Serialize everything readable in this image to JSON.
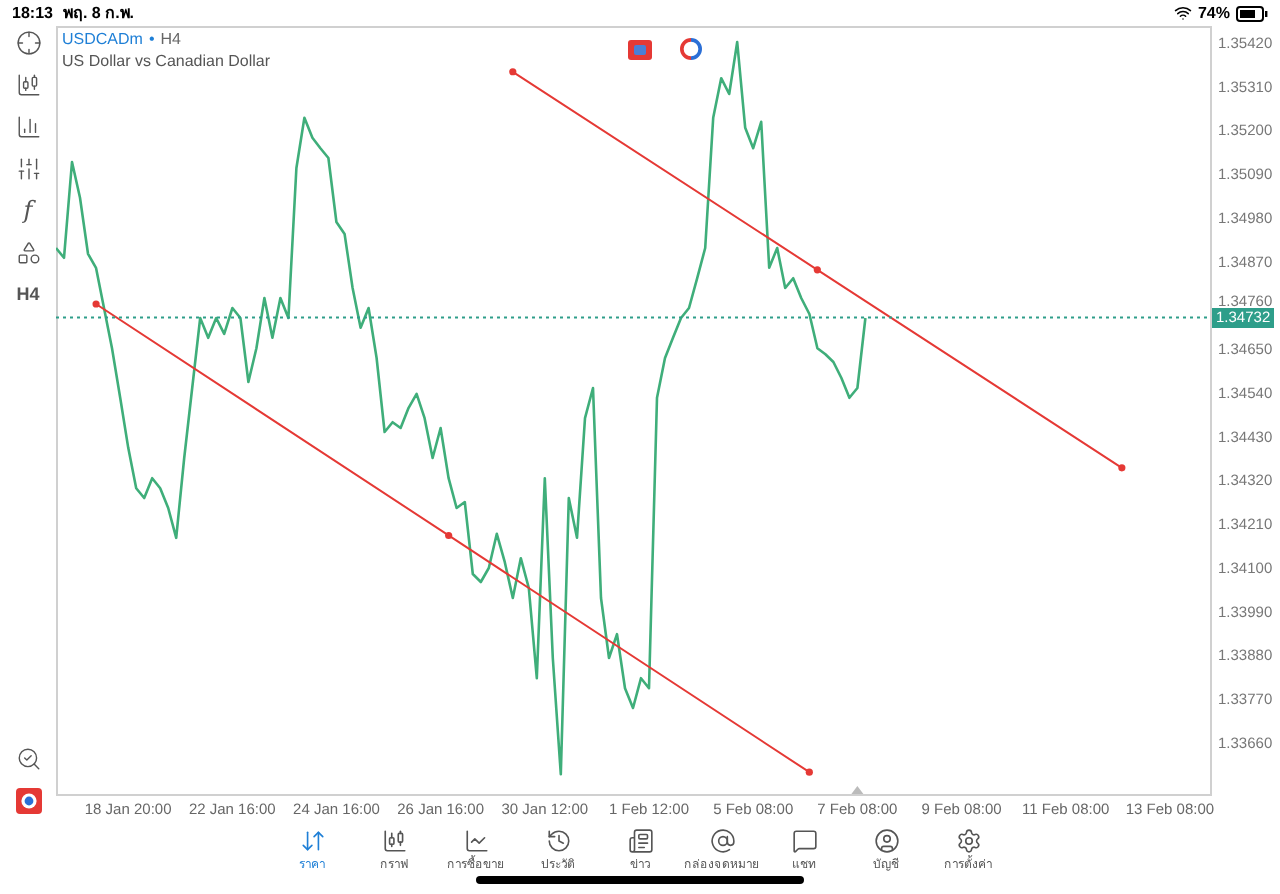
{
  "status_bar": {
    "time": "18:13",
    "date": "พฤ. 8 ก.พ.",
    "battery": "74%"
  },
  "left_toolbar": {
    "function_label": "f",
    "timeframe": "H4"
  },
  "chart_header": {
    "symbol": "USDCADm",
    "separator": "•",
    "timeframe": "H4",
    "description": "US Dollar vs Canadian Dollar"
  },
  "chart": {
    "chart_data": {
      "type": "line",
      "categories": [
        null,
        null,
        null,
        null,
        null,
        null,
        null,
        null,
        null,
        "18 Jan 20:00",
        null,
        null,
        null,
        null,
        null,
        null,
        null,
        null,
        null,
        null,
        null,
        null,
        "22 Jan 16:00",
        null,
        null,
        null,
        null,
        null,
        null,
        null,
        null,
        null,
        null,
        null,
        null,
        "24 Jan 16:00",
        null,
        null,
        null,
        null,
        null,
        null,
        null,
        null,
        null,
        null,
        null,
        null,
        "26 Jan 16:00",
        null,
        null,
        null,
        null,
        null,
        null,
        null,
        null,
        null,
        null,
        null,
        null,
        "30 Jan 12:00",
        null,
        null,
        null,
        null,
        null,
        null,
        null,
        null,
        null,
        null,
        null,
        null,
        "1 Feb 12:00",
        null,
        null,
        null,
        null,
        null,
        null,
        null,
        null,
        null,
        null,
        null,
        null,
        "5 Feb 08:00",
        null,
        null,
        null,
        null,
        null,
        null,
        null,
        null,
        null,
        null,
        null,
        null,
        "7 Feb 08:00",
        null,
        null,
        null,
        null,
        null,
        null,
        null,
        null,
        null,
        null,
        null,
        null,
        "9 Feb 08:00",
        null,
        null,
        null,
        null,
        null,
        null,
        null,
        null,
        null,
        null,
        null,
        null,
        "11 Feb 08:00",
        null,
        null,
        null,
        null,
        null,
        null,
        null,
        null,
        null,
        null,
        null,
        null,
        "13 Feb 08:00",
        null,
        null,
        null,
        null,
        null
      ],
      "ylim": [
        1.33534,
        1.35465
      ],
      "yticks": [
        {
          "value": 1.3542,
          "label": "1.35420"
        },
        {
          "value": 1.3531,
          "label": "1.35310"
        },
        {
          "value": 1.352,
          "label": "1.35200"
        },
        {
          "value": 1.3509,
          "label": "1.35090"
        },
        {
          "value": 1.3498,
          "label": "1.34980"
        },
        {
          "value": 1.3487,
          "label": "1.34870"
        },
        {
          "value": 1.3476,
          "label": "1.34760"
        },
        {
          "value": 1.3465,
          "label": "1.34650"
        },
        {
          "value": 1.3454,
          "label": "1.34540"
        },
        {
          "value": 1.3443,
          "label": "1.34430"
        },
        {
          "value": 1.3432,
          "label": "1.34320"
        },
        {
          "value": 1.3421,
          "label": "1.34210"
        },
        {
          "value": 1.341,
          "label": "1.34100"
        },
        {
          "value": 1.3399,
          "label": "1.33990"
        },
        {
          "value": 1.3388,
          "label": "1.33880"
        },
        {
          "value": 1.3377,
          "label": "1.33770"
        },
        {
          "value": 1.3366,
          "label": "1.33660"
        }
      ],
      "ref_lines": [
        {
          "axis": "y",
          "value": 1.34732,
          "label": "1.34732",
          "color": "#2e9e8a"
        }
      ],
      "series": [
        {
          "color": "#3fae7a",
          "values": [
            1.34907,
            1.34882,
            1.35123,
            1.35033,
            1.34892,
            1.34857,
            1.34756,
            1.34655,
            1.3453,
            1.34405,
            1.34303,
            1.34278,
            1.34328,
            1.34303,
            1.34253,
            1.34178,
            1.34379,
            1.34555,
            1.34731,
            1.34681,
            1.34731,
            1.34691,
            1.34756,
            1.34731,
            1.3457,
            1.34655,
            1.34781,
            1.34681,
            1.34781,
            1.34731,
            1.35108,
            1.35234,
            1.35184,
            1.35158,
            1.35133,
            1.34972,
            1.34942,
            1.34806,
            1.34706,
            1.34756,
            1.3463,
            1.34444,
            1.34469,
            1.34454,
            1.34505,
            1.3454,
            1.34479,
            1.34379,
            1.34454,
            1.34328,
            1.34253,
            1.34268,
            1.34087,
            1.34067,
            1.34102,
            1.34188,
            1.34117,
            1.34027,
            1.34127,
            1.34052,
            1.33825,
            1.34328,
            1.33876,
            1.33584,
            1.34278,
            1.34178,
            1.34479,
            1.34555,
            1.34027,
            1.33876,
            1.33936,
            1.338,
            1.3375,
            1.33825,
            1.338,
            1.3453,
            1.3463,
            1.34681,
            1.34731,
            1.34756,
            1.34831,
            1.34907,
            1.35234,
            1.35334,
            1.35294,
            1.35425,
            1.35209,
            1.35158,
            1.35224,
            1.34857,
            1.34907,
            1.34806,
            1.34831,
            1.34781,
            1.34741,
            1.34655,
            1.3464,
            1.3462,
            1.3458,
            1.3453,
            1.34555,
            1.34731,
            null,
            null,
            null,
            null,
            null,
            null,
            null,
            null,
            null,
            null,
            null,
            null,
            null,
            null,
            null,
            null,
            null,
            null,
            null,
            null,
            null,
            null,
            null,
            null,
            null,
            null,
            null,
            null,
            null,
            null,
            null,
            null,
            null,
            null,
            null,
            null,
            null,
            null,
            null,
            null,
            null,
            null,
            null
          ]
        },
        {
          "color": "#e53935",
          "marker": true,
          "values": [
            null,
            null,
            null,
            null,
            null,
            1.34766,
            null,
            null,
            null,
            null,
            null,
            null,
            null,
            null,
            null,
            null,
            null,
            null,
            null,
            null,
            null,
            null,
            null,
            null,
            null,
            null,
            null,
            null,
            null,
            null,
            null,
            null,
            null,
            null,
            null,
            null,
            null,
            null,
            null,
            null,
            null,
            null,
            null,
            null,
            null,
            null,
            null,
            null,
            null,
            1.34184,
            null,
            null,
            null,
            null,
            null,
            null,
            null,
            null,
            null,
            null,
            null,
            null,
            null,
            null,
            null,
            null,
            null,
            null,
            null,
            null,
            null,
            null,
            null,
            null,
            null,
            null,
            null,
            null,
            null,
            null,
            null,
            null,
            null,
            null,
            null,
            null,
            null,
            null,
            null,
            null,
            null,
            null,
            null,
            null,
            1.33589,
            null,
            null,
            null,
            null,
            null,
            null,
            null,
            null,
            null,
            null,
            null,
            null,
            null,
            null,
            null,
            null,
            null,
            null,
            null,
            null,
            null,
            null,
            null,
            null,
            null,
            null,
            null,
            null,
            null,
            null,
            null,
            null,
            null,
            null,
            null,
            null,
            null,
            null,
            null,
            null,
            null,
            null,
            null,
            null,
            null,
            null,
            null,
            null,
            null,
            null
          ]
        },
        {
          "color": "#e53935",
          "marker": true,
          "values": [
            null,
            null,
            null,
            null,
            null,
            null,
            null,
            null,
            null,
            null,
            null,
            null,
            null,
            null,
            null,
            null,
            null,
            null,
            null,
            null,
            null,
            null,
            null,
            null,
            null,
            null,
            null,
            null,
            null,
            null,
            null,
            null,
            null,
            null,
            null,
            null,
            null,
            null,
            null,
            null,
            null,
            null,
            null,
            null,
            null,
            null,
            null,
            null,
            null,
            null,
            null,
            null,
            null,
            null,
            null,
            null,
            null,
            1.3535,
            null,
            null,
            null,
            null,
            null,
            null,
            null,
            null,
            null,
            null,
            null,
            null,
            null,
            null,
            null,
            null,
            null,
            null,
            null,
            null,
            null,
            null,
            null,
            null,
            null,
            null,
            null,
            null,
            null,
            null,
            null,
            null,
            null,
            null,
            null,
            null,
            null,
            1.34852,
            null,
            null,
            null,
            null,
            null,
            null,
            null,
            null,
            null,
            null,
            null,
            null,
            null,
            null,
            null,
            null,
            null,
            null,
            null,
            null,
            null,
            null,
            null,
            null,
            null,
            null,
            null,
            null,
            null,
            null,
            null,
            null,
            null,
            null,
            null,
            null,
            null,
            1.34354,
            null,
            null,
            null,
            null,
            null,
            null,
            null,
            null,
            null,
            null,
            null
          ]
        }
      ]
    }
  },
  "tab_bar": [
    {
      "label": "ราคา",
      "kind": "quotes",
      "selected": true
    },
    {
      "label": "กราฟ",
      "kind": "chart",
      "selected": false
    },
    {
      "label": "การซื้อขาย",
      "kind": "trade",
      "selected": false
    },
    {
      "label": "ประวัติ",
      "kind": "history",
      "selected": false
    },
    {
      "label": "ข่าว",
      "kind": "news",
      "selected": false
    },
    {
      "label": "กล่องจดหมาย",
      "kind": "mailbox",
      "selected": false
    },
    {
      "label": "แชท",
      "kind": "chat",
      "selected": false
    },
    {
      "label": "บัญชี",
      "kind": "account",
      "selected": false
    },
    {
      "label": "การตั้งค่า",
      "kind": "settings",
      "selected": false
    }
  ]
}
